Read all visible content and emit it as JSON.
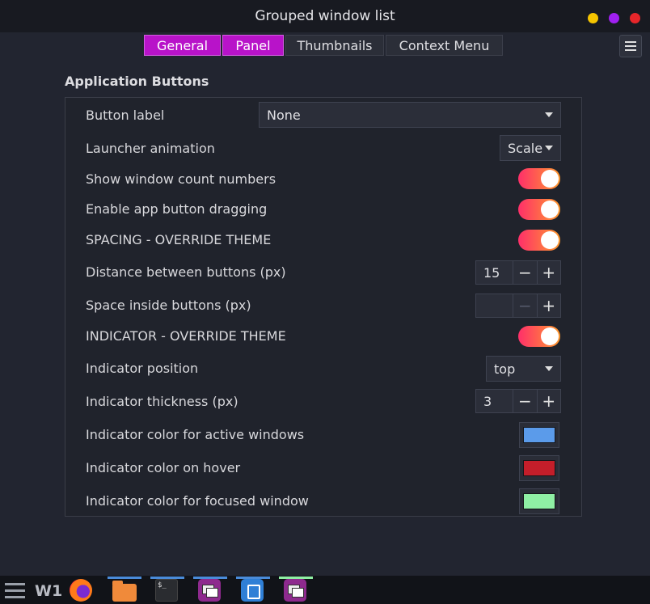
{
  "window": {
    "title": "Grouped window list"
  },
  "tabs": [
    {
      "label": "General"
    },
    {
      "label": "Panel"
    },
    {
      "label": "Thumbnails"
    },
    {
      "label": "Context Menu"
    }
  ],
  "section": {
    "title": "Application Buttons"
  },
  "settings": {
    "button_label": {
      "label": "Button label",
      "value": "None"
    },
    "launcher_animation": {
      "label": "Launcher animation",
      "value": "Scale"
    },
    "show_window_count": {
      "label": "Show window count numbers",
      "on": true
    },
    "enable_dragging": {
      "label": "Enable app button dragging",
      "on": true
    },
    "spacing_override": {
      "label": "SPACING - OVERRIDE THEME",
      "on": true
    },
    "distance_between": {
      "label": "Distance between buttons (px)",
      "value": "15"
    },
    "space_inside": {
      "label": "Space inside buttons (px)",
      "value": ""
    },
    "indicator_override": {
      "label": "INDICATOR - OVERRIDE THEME",
      "on": true
    },
    "indicator_position": {
      "label": "Indicator position",
      "value": "top"
    },
    "indicator_thickness": {
      "label": "Indicator thickness (px)",
      "value": "3"
    },
    "color_active": {
      "label": "Indicator color for active windows",
      "color": "#5b9bea"
    },
    "color_hover": {
      "label": "Indicator color on hover",
      "color": "#c41e2a"
    },
    "color_focused": {
      "label": "Indicator color for focused window",
      "color": "#8ff0a4"
    }
  },
  "stepper": {
    "minus": "−",
    "plus": "+"
  },
  "taskbar": {
    "workspace": "W1",
    "apps": [
      "firefox-icon",
      "files-icon",
      "terminal-icon",
      "window-list-icon",
      "vscode-icon",
      "window-list-icon"
    ],
    "terminal_glyph": "$_"
  },
  "colors": {
    "accent": "#b813c9",
    "toggle_start": "#ff2f6a",
    "toggle_end": "#ff9a2e"
  }
}
